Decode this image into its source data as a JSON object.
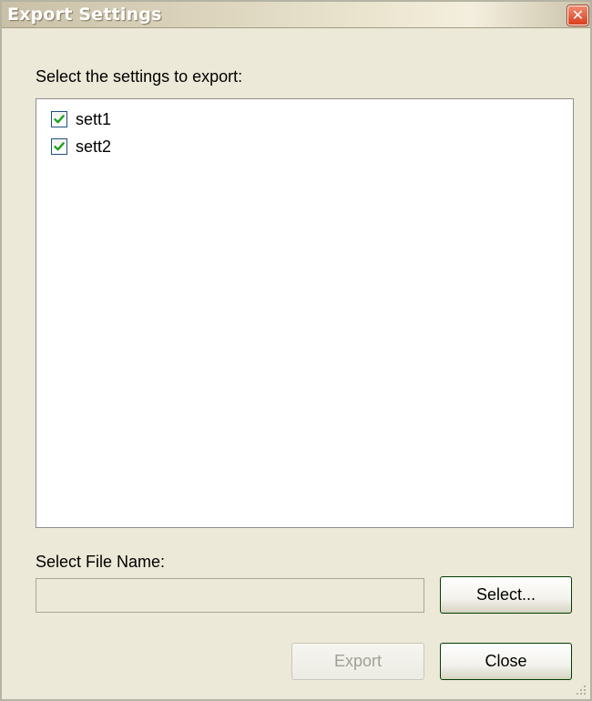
{
  "window": {
    "title": "Export Settings",
    "close_glyph": "✕"
  },
  "settings_list": {
    "label": "Select the settings to export:",
    "items": [
      {
        "label": "sett1",
        "checked": true
      },
      {
        "label": "sett2",
        "checked": true
      }
    ]
  },
  "file": {
    "label": "Select File Name:",
    "value": "",
    "select_button": "Select..."
  },
  "footer": {
    "export_button": "Export",
    "close_button": "Close"
  },
  "colors": {
    "check_green": "#21a121",
    "checkbox_border": "#1c5180",
    "close_red": "#d9401f"
  },
  "icons": {
    "checkbox": "checkmark-icon",
    "close": "close-icon",
    "grip": "resize-grip-icon"
  }
}
